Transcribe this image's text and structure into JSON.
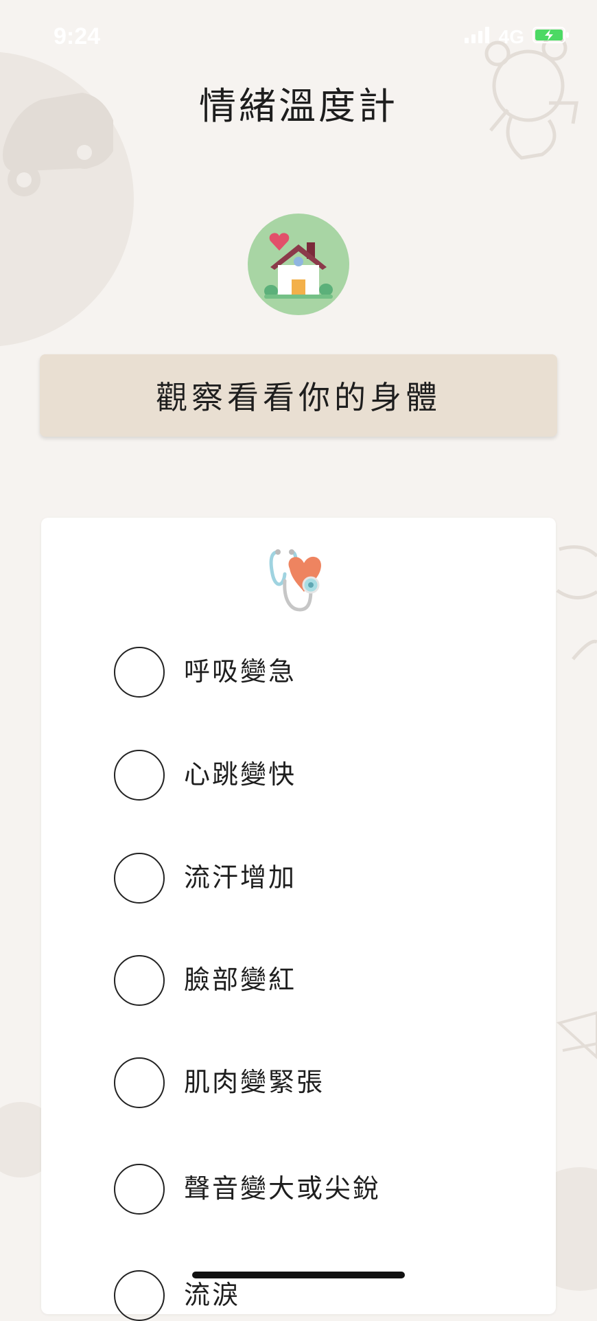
{
  "status_bar": {
    "time": "9:24",
    "network": "4G",
    "icons": [
      "signal-icon",
      "battery-charging-icon"
    ]
  },
  "header": {
    "title": "情緒溫度計"
  },
  "scene": {
    "icon": "home-icon"
  },
  "banner": {
    "text": "觀察看看你的身體"
  },
  "checklist": {
    "icon": "stethoscope-heart-icon",
    "options": [
      {
        "label": "呼吸變急",
        "checked": false
      },
      {
        "label": "心跳變快",
        "checked": false
      },
      {
        "label": "流汗增加",
        "checked": false
      },
      {
        "label": "臉部變紅",
        "checked": false
      },
      {
        "label": "肌肉變緊張",
        "checked": false
      },
      {
        "label": "聲音變大或尖銳",
        "checked": false
      },
      {
        "label": "流淚",
        "checked": false
      }
    ]
  },
  "colors": {
    "background": "#f6f3f0",
    "banner": "#e9dfd2",
    "card": "#ffffff",
    "scene_circle": "#a8d5a4",
    "battery": "#4cd964"
  }
}
